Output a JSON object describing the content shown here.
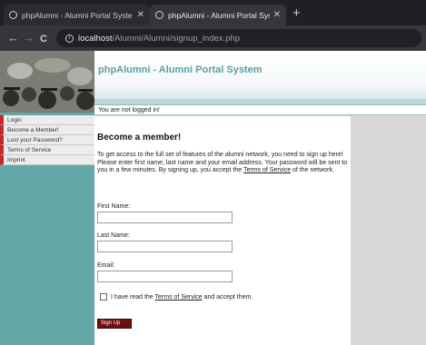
{
  "browser": {
    "tabs": [
      {
        "title": "phpAlumni - Alumni Portal Syste",
        "active": false
      },
      {
        "title": "phpAlumni - Alumni Portal Syste",
        "active": true
      }
    ],
    "new_tab": "+",
    "close_glyph": "✕",
    "nav": {
      "back": "←",
      "forward": "→",
      "reload": "C"
    },
    "url_host": "localhost",
    "url_path": "/Alumni/Alumni/signup_index.php"
  },
  "site": {
    "title": "phpAlumni - Alumni Portal System",
    "status": "You are not logged in!"
  },
  "sidebar": {
    "items": [
      {
        "label": "Login"
      },
      {
        "label": "Become a Member!"
      },
      {
        "label": "Lost your Password?"
      },
      {
        "label": "Terms of Service"
      },
      {
        "label": "Imprint"
      }
    ]
  },
  "main": {
    "heading": "Become a member!",
    "intro_text": "To get access to the full set of features of the alumni network, you need to sign up here! Please enter first name, last name and your email address. Your password will be sent to you in a few minutes. By signing up, you accept the ",
    "intro_link": "Terms of Service",
    "intro_end": " of the network.",
    "fields": {
      "first_name_label": "First Name:",
      "last_name_label": "Last Name:",
      "email_label": "Email:"
    },
    "checkbox_text_pre": "I have read the ",
    "checkbox_link": "Terms of Service",
    "checkbox_text_post": " and accept them.",
    "submit_label": "Sign Up"
  },
  "colors": {
    "brand_teal": "#63a7a7",
    "title_teal": "#5e9f9f",
    "menu_accent": "#c62828",
    "button": "#6e1010"
  }
}
